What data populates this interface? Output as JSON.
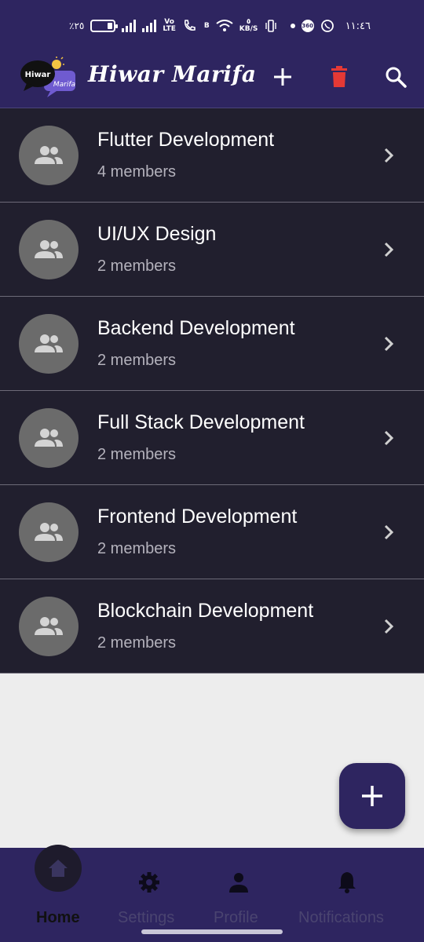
{
  "status_bar": {
    "battery_text": "٪٢٥",
    "network_label_top": "Vo",
    "network_label_bottom": "LTE",
    "data_speed_top": "٥",
    "data_speed_bottom": "KB/S",
    "sim_label": "B",
    "app_badge": "360",
    "time": "١١:٤٦"
  },
  "app_bar": {
    "logo_text_line1": "Hiwar",
    "logo_text_line2": "Marifa",
    "title": "Hiwar Marifa"
  },
  "groups": [
    {
      "name": "Flutter Development",
      "members": "4 members"
    },
    {
      "name": "UI/UX Design",
      "members": "2 members"
    },
    {
      "name": "Backend Development",
      "members": "2 members"
    },
    {
      "name": "Full Stack Development",
      "members": "2 members"
    },
    {
      "name": "Frontend Development",
      "members": "2 members"
    },
    {
      "name": "Blockchain Development",
      "members": "2 members"
    }
  ],
  "bottom_nav": {
    "items": [
      {
        "label": "Home",
        "icon": "home-icon",
        "active": true
      },
      {
        "label": "Settings",
        "icon": "gear-icon",
        "active": false
      },
      {
        "label": "Profile",
        "icon": "person-icon",
        "active": false
      },
      {
        "label": "Notifications",
        "icon": "bell-icon",
        "active": false
      }
    ]
  },
  "colors": {
    "primary": "#2e2560",
    "list_background": "#211f2e",
    "delete": "#e53935",
    "avatar": "#6b6b6b"
  }
}
